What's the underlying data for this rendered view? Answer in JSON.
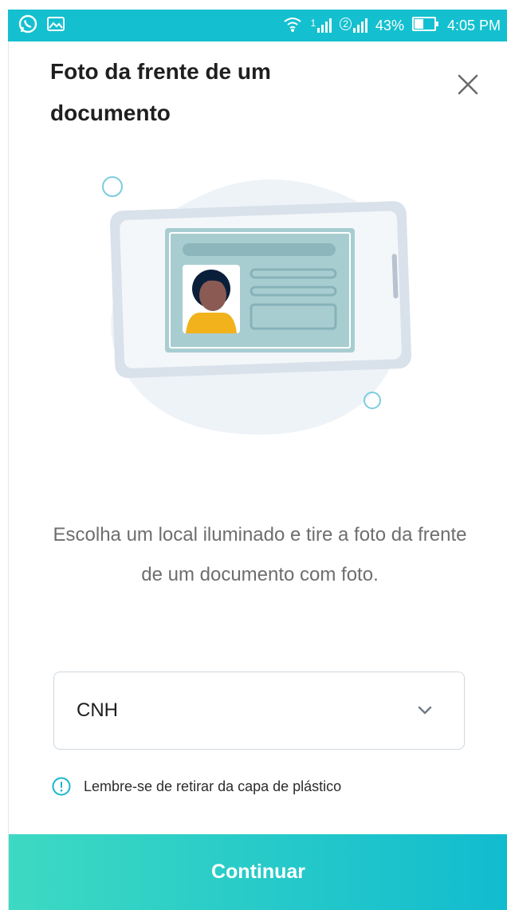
{
  "status_bar": {
    "battery": "43%",
    "time": "4:05 PM",
    "sim1": "1",
    "sim2": "2",
    "icons": [
      "whatsapp-icon",
      "gallery-icon",
      "wifi-icon",
      "signal-icon",
      "battery-icon"
    ]
  },
  "header": {
    "title": "Foto da frente de um documento",
    "close_icon": "close-icon"
  },
  "description": "Escolha um local iluminado e tire a foto da frente de um documento com foto.",
  "document_select": {
    "selected": "CNH",
    "icon": "chevron-down-icon"
  },
  "tip": {
    "text": "Lembre-se de retirar da capa de plástico",
    "icon": "info-icon"
  },
  "continue_button": {
    "label": "Continuar"
  },
  "colors": {
    "status_bar": "#14c0cf",
    "accent": "#12bccf",
    "button_gradient_start": "#3dd9c2",
    "button_gradient_end": "#12bccf"
  }
}
